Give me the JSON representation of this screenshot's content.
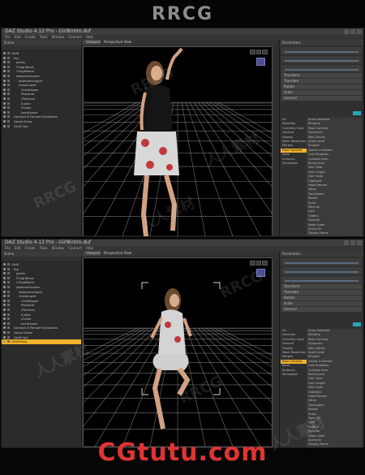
{
  "header": {
    "watermark": "RRCG"
  },
  "footer": {
    "brand": "CGtutu.com"
  },
  "watermarks": [
    "RRCG",
    "人人素材",
    "RRCG",
    "人人素材",
    "RRCG",
    "人人素材",
    "RRCG",
    "人人素材"
  ],
  "app": {
    "title": "DAZ Studio 4.12 Pro - Girl8intro.duf",
    "menu": [
      "File",
      "Edit",
      "Create",
      "Tools",
      "Window",
      "Connect",
      "Help"
    ]
  },
  "screens": [
    {
      "scene_tab": "Scene",
      "viewport_tabs": [
        "Viewport",
        "Perspective View"
      ],
      "tree": [
        {
          "label": "Girl8",
          "indent": 0,
          "selected": false
        },
        {
          "label": "hip",
          "indent": 1,
          "selected": false
        },
        {
          "label": "pelvis",
          "indent": 2,
          "selected": false
        },
        {
          "label": "lThighBend",
          "indent": 2,
          "selected": false
        },
        {
          "label": "rThighBend",
          "indent": 2,
          "selected": false
        },
        {
          "label": "abdomenLower",
          "indent": 2,
          "selected": false
        },
        {
          "label": "abdomenUpper",
          "indent": 3,
          "selected": false
        },
        {
          "label": "chestLower",
          "indent": 3,
          "selected": false
        },
        {
          "label": "chestUpper",
          "indent": 4,
          "selected": false
        },
        {
          "label": "lPectoral",
          "indent": 4,
          "selected": false
        },
        {
          "label": "rPectoral",
          "indent": 4,
          "selected": false
        },
        {
          "label": "lCollar",
          "indent": 4,
          "selected": false
        },
        {
          "label": "rCollar",
          "indent": 4,
          "selected": false
        },
        {
          "label": "neckLower",
          "indent": 4,
          "selected": false
        },
        {
          "label": "Genesis 8 Female Eyelashes",
          "indent": 1,
          "selected": false
        },
        {
          "label": "Qipao Dress",
          "indent": 1,
          "selected": false
        },
        {
          "label": "Girl8 Hair",
          "indent": 1,
          "selected": false
        }
      ],
      "right_tabs": "Parameters",
      "right_bars": [
        "Transform",
        "Translate",
        "Rotate",
        "Scale",
        "General"
      ],
      "ps_categories": [
        "All",
        "Favorites",
        "Currently Used",
        "General",
        "Display",
        "Mesh Resolution",
        "Morphs",
        "Pose Controls",
        "Actor",
        "Surfaces",
        "Simulation"
      ],
      "ps_selected": 7,
      "ps_props": [
        "Show Selected",
        "Bending",
        "Pose Controls",
        "Dynamics",
        "Max Subdiv",
        "SubD Level",
        "Smooth",
        "Visible in Render",
        "Cast Shadows",
        "Collision Item",
        "Bend Joints",
        "Hair Color",
        "Hair Length",
        "Hair Scale",
        "Highlight",
        "Head Render",
        "Value",
        "Translation",
        "Rotate",
        "Scale",
        "Point At",
        "Lock",
        "Hidden",
        "Favorite",
        "Node Label",
        "Scene ID",
        "Display Name",
        "Preset",
        "Reset"
      ]
    },
    {
      "scene_tab": "Scene",
      "viewport_tabs": [
        "Viewport",
        "Perspective View"
      ],
      "tree": [
        {
          "label": "Girl8",
          "indent": 0,
          "selected": false
        },
        {
          "label": "hip",
          "indent": 1,
          "selected": false
        },
        {
          "label": "pelvis",
          "indent": 2,
          "selected": false
        },
        {
          "label": "lThighBend",
          "indent": 2,
          "selected": false
        },
        {
          "label": "rThighBend",
          "indent": 2,
          "selected": false
        },
        {
          "label": "abdomenLower",
          "indent": 2,
          "selected": false
        },
        {
          "label": "abdomenUpper",
          "indent": 3,
          "selected": false
        },
        {
          "label": "chestLower",
          "indent": 3,
          "selected": false
        },
        {
          "label": "chestUpper",
          "indent": 4,
          "selected": false
        },
        {
          "label": "lPectoral",
          "indent": 4,
          "selected": false
        },
        {
          "label": "rPectoral",
          "indent": 4,
          "selected": false
        },
        {
          "label": "lCollar",
          "indent": 4,
          "selected": false
        },
        {
          "label": "rCollar",
          "indent": 4,
          "selected": false
        },
        {
          "label": "neckLower",
          "indent": 4,
          "selected": false
        },
        {
          "label": "Genesis 8 Female Eyelashes",
          "indent": 1,
          "selected": false
        },
        {
          "label": "Qipao Dress",
          "indent": 1,
          "selected": false
        },
        {
          "label": "Girl8 Hair",
          "indent": 1,
          "selected": false
        },
        {
          "label": "Girl8 Pose",
          "indent": 0,
          "selected": true
        }
      ],
      "right_tabs": "Parameters",
      "right_bars": [
        "Transform",
        "Translate",
        "Rotate",
        "Scale",
        "General"
      ],
      "ps_categories": [
        "All",
        "Favorites",
        "Currently Used",
        "General",
        "Display",
        "Mesh Resolution",
        "Morphs",
        "Pose Controls",
        "Actor",
        "Surfaces",
        "Simulation"
      ],
      "ps_selected": 7,
      "ps_props": [
        "Show Selected",
        "Bending",
        "Pose Controls",
        "Dynamics",
        "Max Subdiv",
        "SubD Level",
        "Smooth",
        "Visible in Render",
        "Cast Shadows",
        "Collision Item",
        "Bend Joints",
        "Hair Color",
        "Hair Length",
        "Hair Scale",
        "Highlight",
        "Head Render",
        "Value",
        "Translation",
        "Rotate",
        "Scale",
        "Point At",
        "Lock",
        "Hidden",
        "Favorite",
        "Node Label",
        "Scene ID",
        "Display Name",
        "Preset",
        "Reset"
      ]
    }
  ]
}
